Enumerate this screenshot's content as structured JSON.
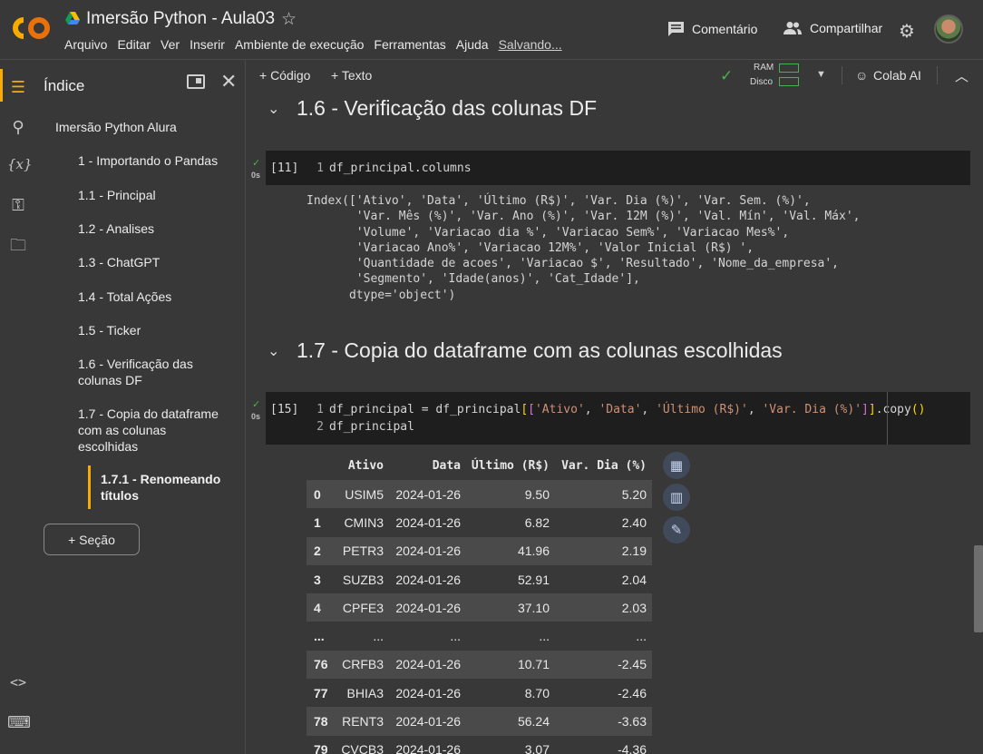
{
  "app": {
    "title": "Imersão Python - Aula03",
    "menu": [
      "Arquivo",
      "Editar",
      "Ver",
      "Inserir",
      "Ambiente de execução",
      "Ferramentas",
      "Ajuda"
    ],
    "saving": "Salvando...",
    "comment": "Comentário",
    "share": "Compartilhar"
  },
  "toolbar": {
    "code": "+ Código",
    "text": "+ Texto",
    "ram": "RAM",
    "disk": "Disco",
    "colab_ai": "Colab AI"
  },
  "sidebar": {
    "title": "Índice",
    "items": [
      "Imersão Python Alura",
      "1 - Importando o Pandas",
      "1.1 - Principal",
      "1.2 - Analises",
      "1.3 - ChatGPT",
      "1.4 - Total Ações",
      "1.5 - Ticker",
      "1.6 - Verificação das colunas DF",
      "1.7 - Copia do dataframe com as colunas escolhidas",
      "1.7.1 - Renomeando títulos"
    ],
    "section_button": "+ Seção"
  },
  "notebook": {
    "h16": "1.6 - Verificação das colunas DF",
    "h17": "1.7 - Copia do dataframe com as colunas escolhidas",
    "cell11": {
      "exec": "[11]",
      "time": "0s",
      "line1": "df_principal.columns"
    },
    "output11": "Index(['Ativo', 'Data', 'Último (R$)', 'Var. Dia (%)', 'Var. Sem. (%)',\n       'Var. Mês (%)', 'Var. Ano (%)', 'Var. 12M (%)', 'Val. Mín', 'Val. Máx',\n       'Volume', 'Variacao dia %', 'Variacao Sem%', 'Variacao Mes%',\n       'Variacao Ano%', 'Variacao 12M%', 'Valor Inicial (R$) ',\n       'Quantidade de acoes', 'Variacao $', 'Resultado', 'Nome_da_empresa',\n       'Segmento', 'Idade(anos)', 'Cat_Idade'],\n      dtype='object')",
    "cell15": {
      "exec": "[15]",
      "time": "0s",
      "line2": "df_principal"
    },
    "table": {
      "columns": [
        "",
        "Ativo",
        "Data",
        "Último (R$)",
        "Var. Dia (%)"
      ],
      "rows": [
        [
          "0",
          "USIM5",
          "2024-01-26",
          "9.50",
          "5.20"
        ],
        [
          "1",
          "CMIN3",
          "2024-01-26",
          "6.82",
          "2.40"
        ],
        [
          "2",
          "PETR3",
          "2024-01-26",
          "41.96",
          "2.19"
        ],
        [
          "3",
          "SUZB3",
          "2024-01-26",
          "52.91",
          "2.04"
        ],
        [
          "4",
          "CPFE3",
          "2024-01-26",
          "37.10",
          "2.03"
        ],
        [
          "...",
          "...",
          "...",
          "...",
          "..."
        ],
        [
          "76",
          "CRFB3",
          "2024-01-26",
          "10.71",
          "-2.45"
        ],
        [
          "77",
          "BHIA3",
          "2024-01-26",
          "8.70",
          "-2.46"
        ],
        [
          "78",
          "RENT3",
          "2024-01-26",
          "56.24",
          "-3.63"
        ],
        [
          "79",
          "CVCB3",
          "2024-01-26",
          "3.07",
          "-4.36"
        ]
      ]
    }
  }
}
